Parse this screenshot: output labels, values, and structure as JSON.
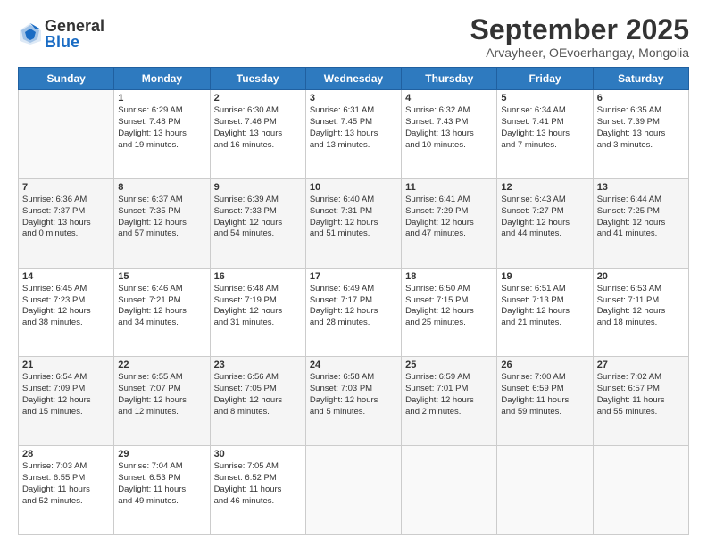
{
  "logo": {
    "general": "General",
    "blue": "Blue"
  },
  "header": {
    "month": "September 2025",
    "location": "Arvayheer, OEvoerhangay, Mongolia"
  },
  "days_of_week": [
    "Sunday",
    "Monday",
    "Tuesday",
    "Wednesday",
    "Thursday",
    "Friday",
    "Saturday"
  ],
  "weeks": [
    [
      {
        "num": "",
        "empty": true
      },
      {
        "num": "1",
        "l1": "Sunrise: 6:29 AM",
        "l2": "Sunset: 7:48 PM",
        "l3": "Daylight: 13 hours",
        "l4": "and 19 minutes."
      },
      {
        "num": "2",
        "l1": "Sunrise: 6:30 AM",
        "l2": "Sunset: 7:46 PM",
        "l3": "Daylight: 13 hours",
        "l4": "and 16 minutes."
      },
      {
        "num": "3",
        "l1": "Sunrise: 6:31 AM",
        "l2": "Sunset: 7:45 PM",
        "l3": "Daylight: 13 hours",
        "l4": "and 13 minutes."
      },
      {
        "num": "4",
        "l1": "Sunrise: 6:32 AM",
        "l2": "Sunset: 7:43 PM",
        "l3": "Daylight: 13 hours",
        "l4": "and 10 minutes."
      },
      {
        "num": "5",
        "l1": "Sunrise: 6:34 AM",
        "l2": "Sunset: 7:41 PM",
        "l3": "Daylight: 13 hours",
        "l4": "and 7 minutes."
      },
      {
        "num": "6",
        "l1": "Sunrise: 6:35 AM",
        "l2": "Sunset: 7:39 PM",
        "l3": "Daylight: 13 hours",
        "l4": "and 3 minutes."
      }
    ],
    [
      {
        "num": "7",
        "l1": "Sunrise: 6:36 AM",
        "l2": "Sunset: 7:37 PM",
        "l3": "Daylight: 13 hours",
        "l4": "and 0 minutes."
      },
      {
        "num": "8",
        "l1": "Sunrise: 6:37 AM",
        "l2": "Sunset: 7:35 PM",
        "l3": "Daylight: 12 hours",
        "l4": "and 57 minutes."
      },
      {
        "num": "9",
        "l1": "Sunrise: 6:39 AM",
        "l2": "Sunset: 7:33 PM",
        "l3": "Daylight: 12 hours",
        "l4": "and 54 minutes."
      },
      {
        "num": "10",
        "l1": "Sunrise: 6:40 AM",
        "l2": "Sunset: 7:31 PM",
        "l3": "Daylight: 12 hours",
        "l4": "and 51 minutes."
      },
      {
        "num": "11",
        "l1": "Sunrise: 6:41 AM",
        "l2": "Sunset: 7:29 PM",
        "l3": "Daylight: 12 hours",
        "l4": "and 47 minutes."
      },
      {
        "num": "12",
        "l1": "Sunrise: 6:43 AM",
        "l2": "Sunset: 7:27 PM",
        "l3": "Daylight: 12 hours",
        "l4": "and 44 minutes."
      },
      {
        "num": "13",
        "l1": "Sunrise: 6:44 AM",
        "l2": "Sunset: 7:25 PM",
        "l3": "Daylight: 12 hours",
        "l4": "and 41 minutes."
      }
    ],
    [
      {
        "num": "14",
        "l1": "Sunrise: 6:45 AM",
        "l2": "Sunset: 7:23 PM",
        "l3": "Daylight: 12 hours",
        "l4": "and 38 minutes."
      },
      {
        "num": "15",
        "l1": "Sunrise: 6:46 AM",
        "l2": "Sunset: 7:21 PM",
        "l3": "Daylight: 12 hours",
        "l4": "and 34 minutes."
      },
      {
        "num": "16",
        "l1": "Sunrise: 6:48 AM",
        "l2": "Sunset: 7:19 PM",
        "l3": "Daylight: 12 hours",
        "l4": "and 31 minutes."
      },
      {
        "num": "17",
        "l1": "Sunrise: 6:49 AM",
        "l2": "Sunset: 7:17 PM",
        "l3": "Daylight: 12 hours",
        "l4": "and 28 minutes."
      },
      {
        "num": "18",
        "l1": "Sunrise: 6:50 AM",
        "l2": "Sunset: 7:15 PM",
        "l3": "Daylight: 12 hours",
        "l4": "and 25 minutes."
      },
      {
        "num": "19",
        "l1": "Sunrise: 6:51 AM",
        "l2": "Sunset: 7:13 PM",
        "l3": "Daylight: 12 hours",
        "l4": "and 21 minutes."
      },
      {
        "num": "20",
        "l1": "Sunrise: 6:53 AM",
        "l2": "Sunset: 7:11 PM",
        "l3": "Daylight: 12 hours",
        "l4": "and 18 minutes."
      }
    ],
    [
      {
        "num": "21",
        "l1": "Sunrise: 6:54 AM",
        "l2": "Sunset: 7:09 PM",
        "l3": "Daylight: 12 hours",
        "l4": "and 15 minutes."
      },
      {
        "num": "22",
        "l1": "Sunrise: 6:55 AM",
        "l2": "Sunset: 7:07 PM",
        "l3": "Daylight: 12 hours",
        "l4": "and 12 minutes."
      },
      {
        "num": "23",
        "l1": "Sunrise: 6:56 AM",
        "l2": "Sunset: 7:05 PM",
        "l3": "Daylight: 12 hours",
        "l4": "and 8 minutes."
      },
      {
        "num": "24",
        "l1": "Sunrise: 6:58 AM",
        "l2": "Sunset: 7:03 PM",
        "l3": "Daylight: 12 hours",
        "l4": "and 5 minutes."
      },
      {
        "num": "25",
        "l1": "Sunrise: 6:59 AM",
        "l2": "Sunset: 7:01 PM",
        "l3": "Daylight: 12 hours",
        "l4": "and 2 minutes."
      },
      {
        "num": "26",
        "l1": "Sunrise: 7:00 AM",
        "l2": "Sunset: 6:59 PM",
        "l3": "Daylight: 11 hours",
        "l4": "and 59 minutes."
      },
      {
        "num": "27",
        "l1": "Sunrise: 7:02 AM",
        "l2": "Sunset: 6:57 PM",
        "l3": "Daylight: 11 hours",
        "l4": "and 55 minutes."
      }
    ],
    [
      {
        "num": "28",
        "l1": "Sunrise: 7:03 AM",
        "l2": "Sunset: 6:55 PM",
        "l3": "Daylight: 11 hours",
        "l4": "and 52 minutes."
      },
      {
        "num": "29",
        "l1": "Sunrise: 7:04 AM",
        "l2": "Sunset: 6:53 PM",
        "l3": "Daylight: 11 hours",
        "l4": "and 49 minutes."
      },
      {
        "num": "30",
        "l1": "Sunrise: 7:05 AM",
        "l2": "Sunset: 6:52 PM",
        "l3": "Daylight: 11 hours",
        "l4": "and 46 minutes."
      },
      {
        "num": "",
        "empty": true
      },
      {
        "num": "",
        "empty": true
      },
      {
        "num": "",
        "empty": true
      },
      {
        "num": "",
        "empty": true
      }
    ]
  ]
}
